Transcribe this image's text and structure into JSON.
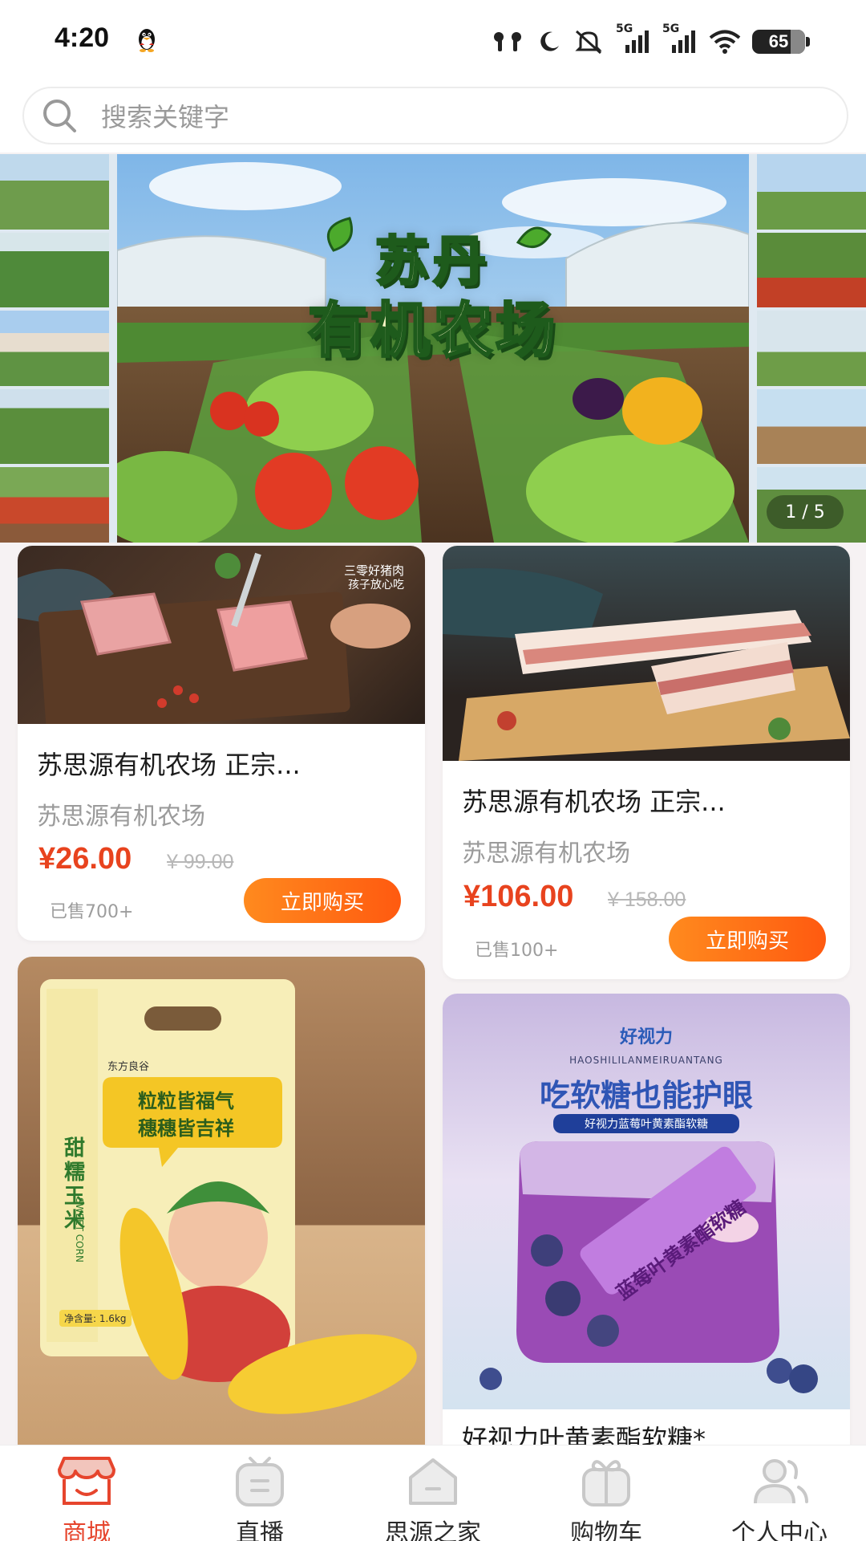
{
  "status_bar": {
    "time": "4:20",
    "battery": "65",
    "network_1": "5G",
    "network_2": "5G"
  },
  "search": {
    "placeholder": "搜索关键字"
  },
  "banner": {
    "title_line1": "苏丹",
    "title_line2": "有机农场",
    "pager": "1 / 5"
  },
  "products": [
    {
      "image_caption_1": "三零好猪肉",
      "image_caption_2": "孩子放心吃",
      "title": "苏思源有机农场 正宗...",
      "shop": "苏思源有机农场",
      "price": "¥26.00",
      "original_price": "¥ 99.00",
      "sold": "已售700+",
      "buy_label": "立即购买"
    },
    {
      "title": "苏思源有机农场 正宗...",
      "shop": "苏思源有机农场",
      "price": "¥106.00",
      "original_price": "¥ 158.00",
      "sold": "已售100+",
      "buy_label": "立即购买"
    },
    {
      "brand": "东方良谷",
      "product_name": "甜糯玉米",
      "product_name_en": "SWEET CORN",
      "slogan_1": "粒粒皆福气",
      "slogan_2": "穗穗皆吉祥",
      "net_weight": "净含量: 1.6kg"
    },
    {
      "brand": "好视力",
      "brand_pinyin": "HAOSHILILANMEIRUANTANG",
      "headline": "吃软糖也能护眼",
      "subline": "好视力蓝莓叶黄素酯软糖",
      "pack_text": "蓝莓叶黄素酯软糖",
      "title": "好视力叶黄素酯软糖*"
    }
  ],
  "tabbar": {
    "items": [
      {
        "label": "商城",
        "active": true
      },
      {
        "label": "直播",
        "active": false
      },
      {
        "label": "思源之家",
        "active": false
      },
      {
        "label": "购物车",
        "active": false
      },
      {
        "label": "个人中心",
        "active": false
      }
    ]
  },
  "colors": {
    "accent": "#e6452d",
    "price": "#e8431e",
    "buy_button": "#ff6a14"
  }
}
